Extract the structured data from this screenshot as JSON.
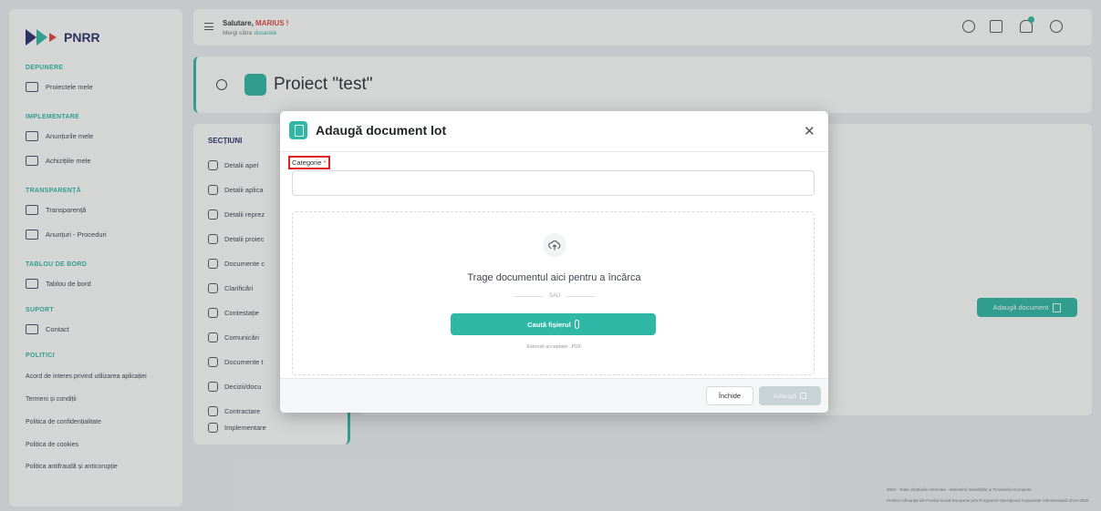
{
  "app": {
    "logo_text": "PNRR"
  },
  "sidebar": {
    "sections": [
      {
        "title": "DEPUNERE",
        "items": [
          {
            "label": "Proiectele mele",
            "icon": "document-icon"
          }
        ]
      },
      {
        "title": "IMPLEMENTARE",
        "items": [
          {
            "label": "Anunțurile mele",
            "icon": "folder-icon"
          },
          {
            "label": "Achizițiile mele",
            "icon": "file-icon"
          }
        ]
      },
      {
        "title": "TRANSPARENȚĂ",
        "items": [
          {
            "label": "Transparență",
            "icon": "table-icon"
          },
          {
            "label": "Anunțuri - Proceduri",
            "icon": "copy-icon"
          }
        ]
      },
      {
        "title": "TABLOU DE BORD",
        "items": [
          {
            "label": "Tablou de bord",
            "icon": "dashboard-icon"
          }
        ]
      },
      {
        "title": "SUPORT",
        "items": [
          {
            "label": "Contact",
            "icon": "mail-icon"
          }
        ]
      },
      {
        "title": "POLITICI",
        "items": []
      }
    ],
    "policy_links": [
      "Acord de interes privind utilizarea aplicației",
      "Termeni și condiții",
      "Politica de confidențialitate",
      "Politica de cookies",
      "Politica antifraudă și anticorupție"
    ]
  },
  "topbar": {
    "greeting": "Salutare,",
    "user_name": "MARIUS !",
    "goto_prefix": "Mergi către",
    "goto_link": "dosarele"
  },
  "project": {
    "title": "Proiect \"test\""
  },
  "sections_panel": {
    "title": "SECȚIUNI",
    "items": [
      "Detalii apel",
      "Detalii aplica",
      "Detalii reprez",
      "Detalii proiec",
      "Documente c",
      "Clarificări",
      "Contestație",
      "Comunicări",
      "Documente t",
      "Decizii/docu",
      "Contractare",
      "Implementare"
    ]
  },
  "content": {
    "add_document_label": "Adaugă document"
  },
  "footer": {
    "line1": "2023 - Toate drepturile rezervate - Ministerul Investițiilor și Proiectelor Europene",
    "line2": "Proiect cofinanțat din Fondul Social European prin Programul Operațional Capacitate Administrativă 2014-2020"
  },
  "modal": {
    "title": "Adaugă document lot",
    "category_label": "Categorie",
    "required_mark": "*",
    "category_value": "",
    "drag_text": "Trage documentul aici pentru a încărca",
    "or_text": "SAU",
    "browse_label": "Caută fișierul",
    "extensions_note": "Extensii acceptate: .PDF",
    "close_label": "Închide",
    "save_label": "Adaugă"
  },
  "colors": {
    "accent": "#2fb8a6",
    "brand_navy": "#2a2f6b",
    "danger": "#e0443a",
    "edit_blue": "#3f7be0"
  }
}
